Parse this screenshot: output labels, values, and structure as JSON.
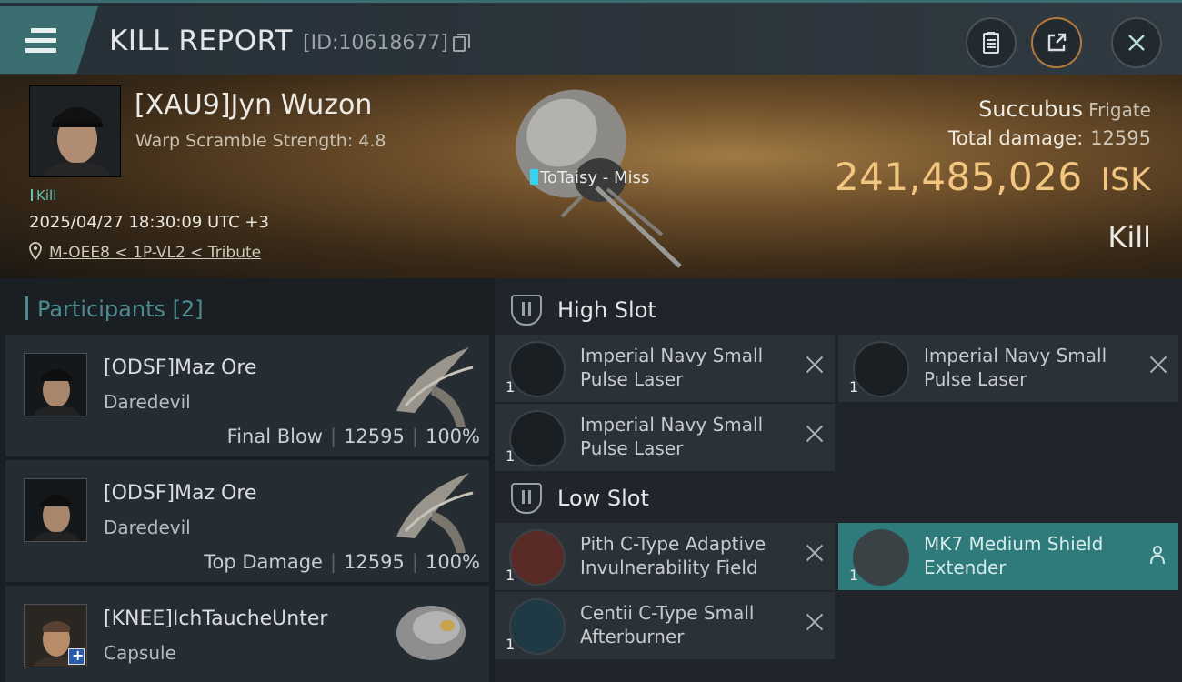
{
  "header": {
    "title": "KILL REPORT",
    "report_id": "[ID:10618677]"
  },
  "victim": {
    "name": "[XAU9]Jyn Wuzon",
    "warp_scramble": "Warp Scramble Strength: 4.8",
    "tag": "Kill",
    "datetime": "2025/04/27 18:30:09 UTC +3",
    "location": "M-OEE8 < 1P-VL2 < Tribute",
    "hit_label": "ToTaisy - Miss",
    "ship_name": "Succubus",
    "ship_class": "Frigate",
    "total_damage_label": "Total damage:",
    "total_damage": "12595",
    "isk_value": "241,485,026",
    "isk_unit": "ISK",
    "result": "Kill"
  },
  "participants": {
    "title": "Participants [2]",
    "rows": [
      {
        "name": "[ODSF]Maz Ore",
        "ship": "Daredevil",
        "role": "Final Blow",
        "damage": "12595",
        "percent": "100%"
      },
      {
        "name": "[ODSF]Maz Ore",
        "ship": "Daredevil",
        "role": "Top Damage",
        "damage": "12595",
        "percent": "100%"
      },
      {
        "name": "[KNEE]IchTaucheUnter",
        "ship": "Capsule"
      }
    ]
  },
  "fitting": {
    "high_slot_title": "High Slot",
    "low_slot_title": "Low Slot",
    "high_modules": [
      {
        "name": "Imperial Navy Small Pulse Laser",
        "qty": "1"
      },
      {
        "name": "Imperial Navy Small Pulse Laser",
        "qty": "1"
      },
      {
        "name": "Imperial Navy Small Pulse Laser",
        "qty": "1"
      }
    ],
    "low_modules": [
      {
        "name": "Pith C-Type Adaptive Invulnerability Field",
        "qty": "1"
      },
      {
        "name": "MK7 Medium Shield Extender",
        "qty": "1"
      },
      {
        "name": "Centii C-Type Small Afterburner",
        "qty": "1"
      }
    ]
  },
  "colors": {
    "accent_teal": "#3a6e70",
    "isk_gold": "#f2c680",
    "highlight_module": "#2f7b7b"
  }
}
